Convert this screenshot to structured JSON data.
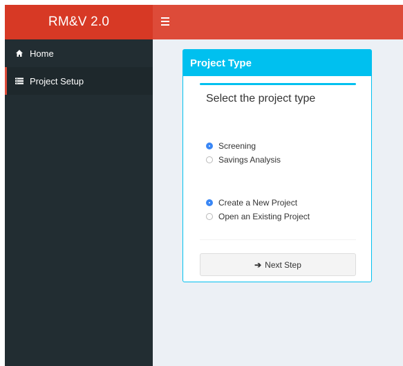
{
  "header": {
    "brand": "RM&V 2.0",
    "menu_icon": "hamburger-icon",
    "colors": {
      "brand_bg": "#d73925",
      "navbar_bg": "#dd4b39"
    }
  },
  "sidebar": {
    "items": [
      {
        "label": "Home",
        "icon": "home-icon",
        "active": false
      },
      {
        "label": "Project Setup",
        "icon": "list-icon",
        "active": true
      }
    ]
  },
  "main": {
    "box": {
      "title": "Project Type",
      "question": "Select the project type",
      "type_options": [
        {
          "label": "Screening",
          "checked": true
        },
        {
          "label": "Savings Analysis",
          "checked": false
        }
      ],
      "project_options": [
        {
          "label": "Create a New Project",
          "checked": true
        },
        {
          "label": "Open an Existing Project",
          "checked": false
        }
      ],
      "next_button": {
        "icon": "arrow-right-icon",
        "label": "Next Step"
      },
      "accent_color": "#00c0ef"
    }
  }
}
